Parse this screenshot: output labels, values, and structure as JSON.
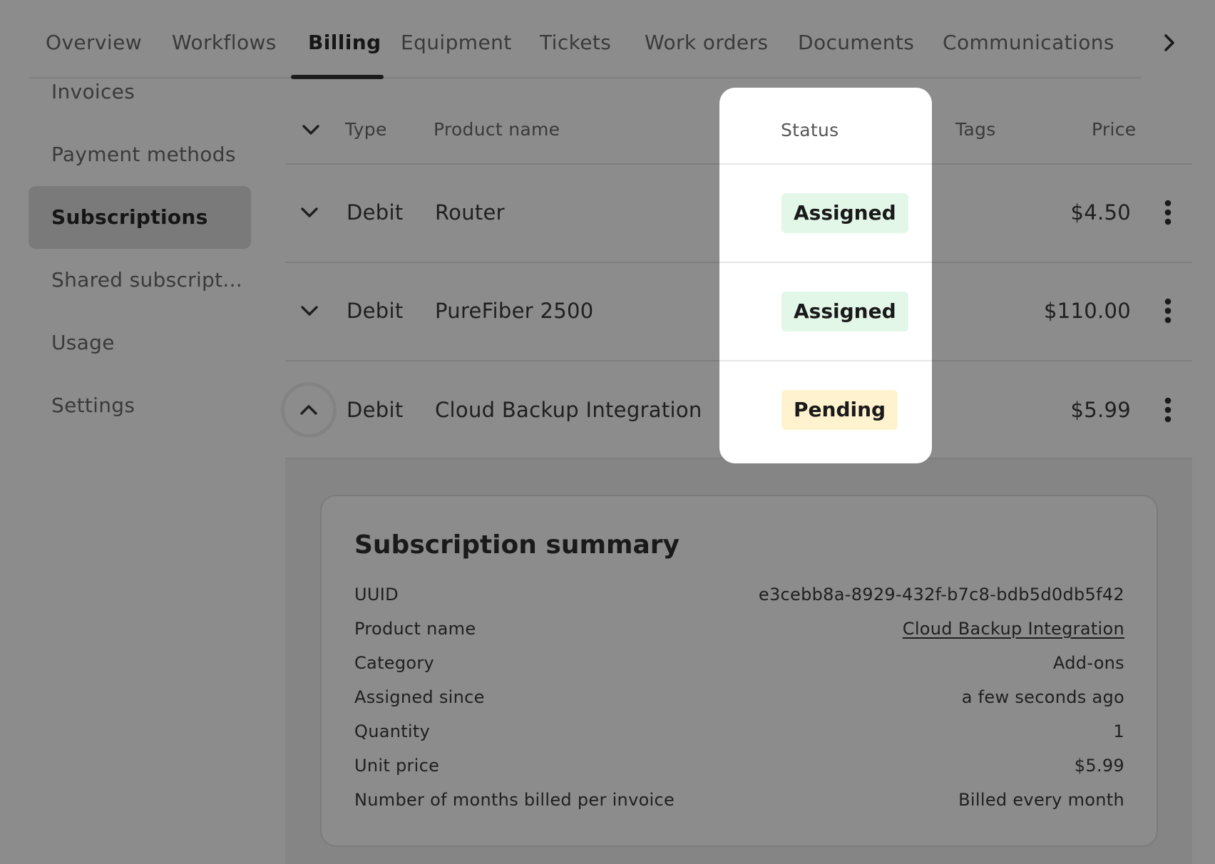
{
  "tabs": [
    {
      "label": "Overview"
    },
    {
      "label": "Workflows"
    },
    {
      "label": "Billing",
      "active": true
    },
    {
      "label": "Equipment"
    },
    {
      "label": "Tickets"
    },
    {
      "label": "Work orders"
    },
    {
      "label": "Documents"
    },
    {
      "label": "Communications"
    }
  ],
  "sidebar": {
    "items": [
      {
        "label": "Invoices"
      },
      {
        "label": "Payment methods"
      },
      {
        "label": "Subscriptions",
        "active": true
      },
      {
        "label": "Shared subscript..."
      },
      {
        "label": "Usage"
      },
      {
        "label": "Settings"
      }
    ]
  },
  "table": {
    "headers": {
      "type": "Type",
      "product": "Product name",
      "status": "Status",
      "tags": "Tags",
      "price": "Price"
    },
    "rows": [
      {
        "type": "Debit",
        "product": "Router",
        "status": "Assigned",
        "price": "$4.50"
      },
      {
        "type": "Debit",
        "product": "PureFiber 2500",
        "status": "Assigned",
        "price": "$110.00"
      },
      {
        "type": "Debit",
        "product": "Cloud Backup Integration",
        "status": "Pending",
        "price": "$5.99",
        "expanded": true
      }
    ]
  },
  "summary": {
    "title": "Subscription summary",
    "fields": [
      {
        "label": "UUID",
        "value": "e3cebb8a-8929-432f-b7c8-bdb5d0db5f42"
      },
      {
        "label": "Product name",
        "value": "Cloud Backup Integration"
      },
      {
        "label": "Category",
        "value": "Add-ons"
      },
      {
        "label": "Assigned since",
        "value": "a few seconds ago"
      },
      {
        "label": "Quantity",
        "value": "1"
      },
      {
        "label": "Unit price",
        "value": "$5.99"
      },
      {
        "label": "Number of months billed per invoice",
        "value": "Billed every month"
      }
    ]
  },
  "colors": {
    "assigned_badge": "#e3f7e8",
    "pending_badge": "#fff3cf",
    "overlay": "#8c8c8c",
    "spotlight": "#ffffff"
  }
}
